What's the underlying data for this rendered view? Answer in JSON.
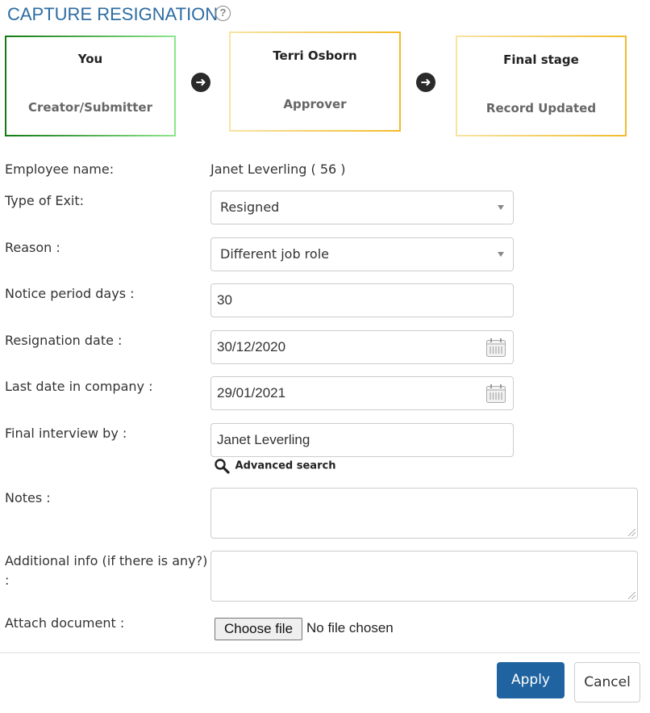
{
  "header": {
    "title": "CAPTURE RESIGNATION",
    "help_icon": "?"
  },
  "workflow": {
    "stages": [
      {
        "name": "You",
        "role": "Creator/Submitter",
        "status_color": "#137a13"
      },
      {
        "name": "Terri Osborn",
        "role": "Approver",
        "status_color": "#f2bb2c"
      },
      {
        "name": "Final stage",
        "role": "Record Updated",
        "status_color": "#f2bb2c"
      }
    ],
    "arrow_glyph": "➜"
  },
  "form": {
    "employee_name": {
      "label": "Employee name:",
      "value": "Janet Leverling ( 56 )"
    },
    "type_of_exit": {
      "label": "Type of Exit:",
      "value": "Resigned"
    },
    "reason": {
      "label": "Reason :",
      "value": "Different job role"
    },
    "notice_period": {
      "label": "Notice period days :",
      "value": "30"
    },
    "resignation_date": {
      "label": "Resignation date :",
      "value": "30/12/2020"
    },
    "last_date": {
      "label": "Last date in company :",
      "value": "29/01/2021"
    },
    "final_interview": {
      "label": "Final interview by :",
      "value": "Janet Leverling",
      "advanced_search": "Advanced search"
    },
    "notes": {
      "label": "Notes :",
      "value": ""
    },
    "additional_info": {
      "label_line1": "Additional info (if there is any?)",
      "label_line2": ":",
      "value": ""
    },
    "attach": {
      "label": "Attach document :",
      "button": "Choose file",
      "status": "No file chosen"
    }
  },
  "footer": {
    "apply": "Apply",
    "cancel": "Cancel",
    "apply_color": "#1f63a0"
  }
}
